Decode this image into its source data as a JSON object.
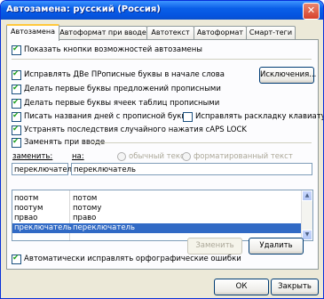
{
  "window": {
    "title": "Автозамена: русский (Россия)"
  },
  "tabs": [
    "Автозамена",
    "Автоформат при вводе",
    "Автотекст",
    "Автоформат",
    "Смарт-теги"
  ],
  "options": {
    "show_buttons": "Показать кнопки возможностей автозамены",
    "fix_two_caps": "Исправлять ДВе ПРописные буквы в начале слова",
    "capitalize_sentences": "Делать первые буквы предложений прописными",
    "capitalize_table_cells": "Делать первые буквы ячеек таблиц прописными",
    "capitalize_days": "Писать названия дней с прописной буквы",
    "fix_caps_lock": "Устранять последствия случайного нажатия cAPS LOCK",
    "fix_keyboard_layout": "Исправлять раскладку клавиатуры",
    "replace_as_you_type": "Заменять при вводе",
    "auto_spelling": "Автоматически исправлять орфографические ошибки"
  },
  "replace": {
    "replace_label": "заменить:",
    "with_label": "на:",
    "plain_text": "обычный текст",
    "formatted_text": "форматированный текст",
    "replace_value": "переключатель",
    "with_value": "переключатель"
  },
  "list": [
    {
      "from": "поотм",
      "to": "потом"
    },
    {
      "from": "поотум",
      "to": "потому"
    },
    {
      "from": "првао",
      "to": "право"
    },
    {
      "from": "преключатель",
      "to": "переключатель"
    }
  ],
  "buttons": {
    "exceptions": "Исключения...",
    "replace": "Заменить",
    "delete": "Удалить",
    "ok": "ОК",
    "close": "Закрыть"
  },
  "colors": {
    "accent": "#0a5fe8",
    "selection": "#316ac5",
    "check": "#21a121"
  }
}
